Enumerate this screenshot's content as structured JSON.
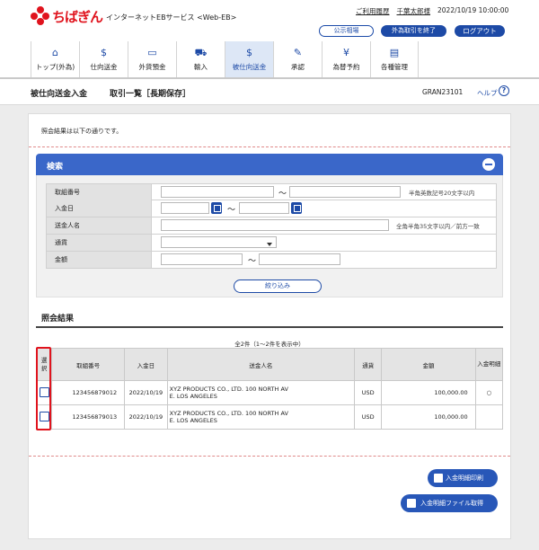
{
  "header": {
    "brand": "ちばぎん",
    "service": "インターネットEBサービス <Web-EB>",
    "usage_link": "ご利用履歴",
    "user": "千葉太郎様",
    "datetime": "2022/10/19 10:00:00",
    "rate_button": "公示相場",
    "fx_end_button": "外為取引を終了",
    "logout_button": "ログアウト"
  },
  "nav": [
    {
      "label": "トップ(外為)",
      "icon": "home-icon"
    },
    {
      "label": "仕向送金",
      "icon": "outward-remit-icon"
    },
    {
      "label": "外貨預金",
      "icon": "deposit-icon"
    },
    {
      "label": "輸入",
      "icon": "import-icon"
    },
    {
      "label": "被仕向送金",
      "icon": "inward-remit-icon"
    },
    {
      "label": "承認",
      "icon": "approval-icon"
    },
    {
      "label": "為替予約",
      "icon": "exchange-icon"
    },
    {
      "label": "各種管理",
      "icon": "management-icon"
    }
  ],
  "active_nav": "被仕向送金",
  "title": {
    "main": "被仕向送金入金",
    "sub": "取引一覧［長期保存］",
    "screen_id": "GRAN23101",
    "help": "ヘルプ",
    "help_icon": "?"
  },
  "intro": "照会結果は以下の通りです。",
  "search": {
    "title": "検索",
    "fields": {
      "ref_no": "取組番号",
      "date": "入金日",
      "remitter": "送金人名",
      "currency": "通貨",
      "amount": "金額"
    },
    "tilde": "～",
    "ref_hint": "半角英数記号20文字以内",
    "name_hint": "全角半角35文字以内／前方一致",
    "filter_button": "絞り込み"
  },
  "results": {
    "title": "照会結果",
    "count": "全2件（1～2件を表示中）",
    "columns": [
      "選択",
      "取組番号",
      "入金日",
      "送金人名",
      "通貨",
      "金額",
      "入金明細"
    ],
    "rows": [
      {
        "ref": "123456879012",
        "date": "2022/10/19",
        "name1": "XYZ PRODUCTS CO., LTD. 100 NORTH AV",
        "name2": "E. LOS ANGELES",
        "currency": "USD",
        "amount": "100,000.00",
        "detail": "○"
      },
      {
        "ref": "123456879013",
        "date": "2022/10/19",
        "name1": "XYZ PRODUCTS CO., LTD. 100 NORTH AV",
        "name2": "E. LOS ANGELES",
        "currency": "USD",
        "amount": "100,000.00",
        "detail": ""
      }
    ]
  },
  "actions": {
    "print": "入金明細印刷",
    "file": "入金明細ファイル取得"
  },
  "colors": {
    "brand": "#e0131d",
    "primary": "#1d4aa6",
    "search_header": "#3a67c9"
  }
}
